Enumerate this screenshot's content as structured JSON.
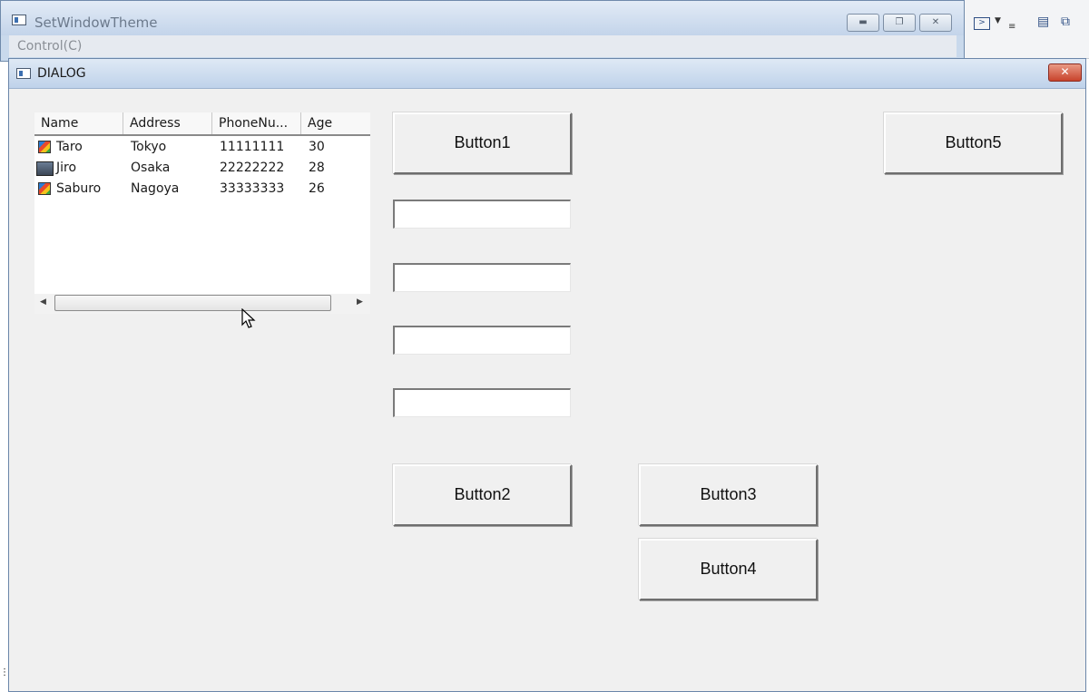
{
  "background_window": {
    "title": "SetWindowTheme",
    "menu": [
      "Control(C)"
    ],
    "caption_buttons": [
      "minimize",
      "restore",
      "close"
    ]
  },
  "toolbar_fragment": {
    "icons": [
      "console-icon",
      "dropdown-arrow-icon",
      "overflow-icon",
      "new-window-icon",
      "switch-windows-icon"
    ]
  },
  "dialog": {
    "title": "DIALOG",
    "close_glyph": "✕"
  },
  "listview": {
    "columns": [
      "Name",
      "Address",
      "PhoneNu...",
      "Age"
    ],
    "rows": [
      {
        "icon": "pencil-icon",
        "name": "Taro",
        "address": "Tokyo",
        "phone": "11111111",
        "age": "30"
      },
      {
        "icon": "computer-icon",
        "name": "Jiro",
        "address": "Osaka",
        "phone": "22222222",
        "age": "28"
      },
      {
        "icon": "pencil-icon",
        "name": "Saburo",
        "address": "Nagoya",
        "phone": "33333333",
        "age": "26"
      }
    ]
  },
  "buttons": {
    "b1": "Button1",
    "b2": "Button2",
    "b3": "Button3",
    "b4": "Button4",
    "b5": "Button5"
  },
  "edits": {
    "e1": "",
    "e2": "",
    "e3": "",
    "e4": ""
  },
  "colors": {
    "dialog_bg": "#f0f0f0",
    "titlebar": "#c3d4ea",
    "close_red": "#c8432c"
  }
}
